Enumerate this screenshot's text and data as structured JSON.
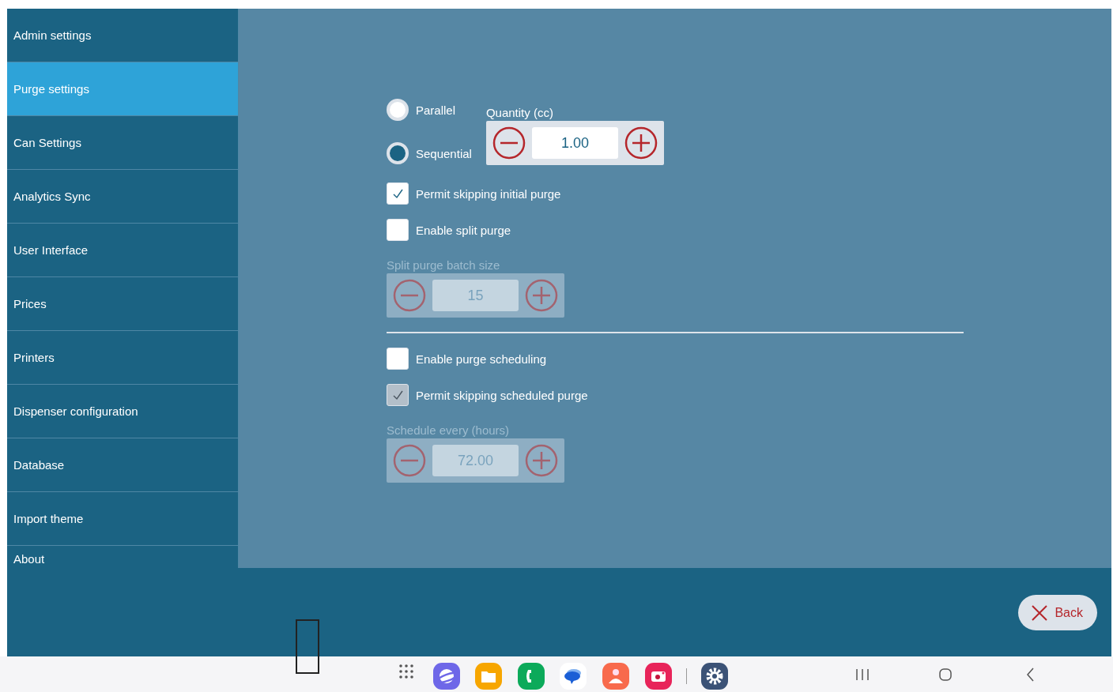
{
  "sidebar": {
    "items": [
      {
        "label": "Admin settings",
        "selected": false
      },
      {
        "label": "Purge settings",
        "selected": true
      },
      {
        "label": "Can Settings",
        "selected": false
      },
      {
        "label": "Analytics Sync",
        "selected": false
      },
      {
        "label": "User Interface",
        "selected": false
      },
      {
        "label": "Prices",
        "selected": false
      },
      {
        "label": "Printers",
        "selected": false
      },
      {
        "label": "Dispenser configuration",
        "selected": false
      },
      {
        "label": "Database",
        "selected": false
      },
      {
        "label": "Import theme",
        "selected": false
      },
      {
        "label": "About",
        "selected": false
      }
    ]
  },
  "purge": {
    "mode_options": [
      {
        "label": "Parallel",
        "selected": false
      },
      {
        "label": "Sequential",
        "selected": true
      }
    ],
    "quantity": {
      "label": "Quantity (cc)",
      "value": "1.00",
      "disabled": false
    },
    "options": [
      {
        "kind": "checkbox",
        "label": "Permit skipping initial purge",
        "checked": true,
        "disabled": false
      },
      {
        "kind": "checkbox",
        "label": "Enable split purge",
        "checked": false,
        "disabled": false
      },
      {
        "kind": "stepper",
        "label": "Split purge batch size",
        "value": "15",
        "disabled": true
      },
      {
        "kind": "divider"
      },
      {
        "kind": "checkbox",
        "label": "Enable purge scheduling",
        "checked": false,
        "disabled": false
      },
      {
        "kind": "checkbox",
        "label": "Permit skipping scheduled purge",
        "checked": true,
        "disabled": true
      },
      {
        "kind": "stepper",
        "label": "Schedule every (hours)",
        "value": "72.00",
        "disabled": true
      }
    ]
  },
  "back_button": {
    "label": "Back"
  }
}
